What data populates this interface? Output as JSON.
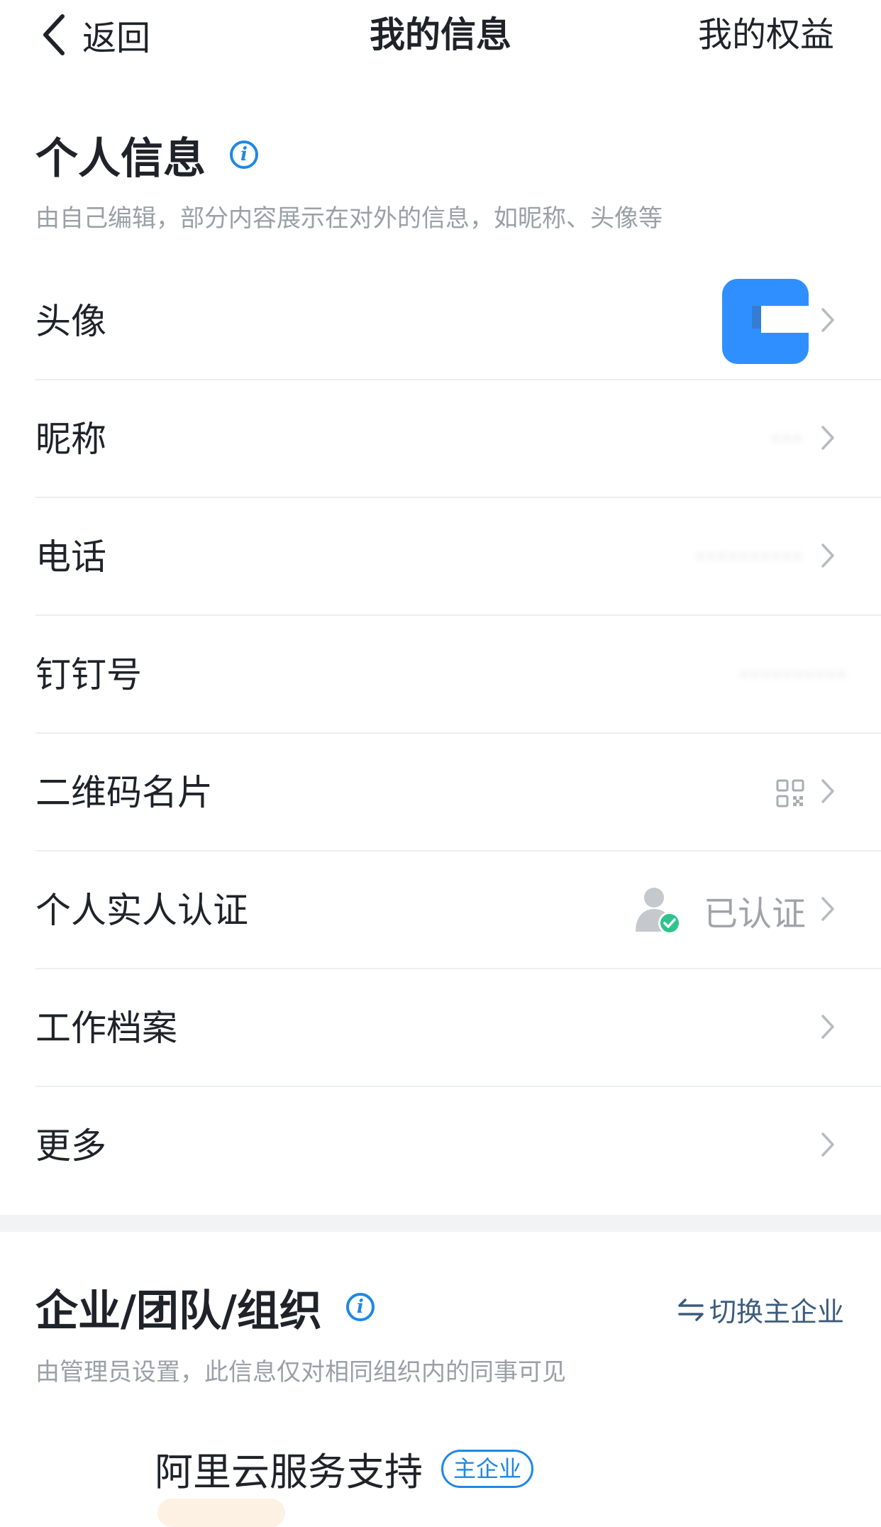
{
  "nav": {
    "back_label": "返回",
    "title": "我的信息",
    "right_label": "我的权益"
  },
  "personal": {
    "title": "个人信息",
    "subtitle": "由自己编辑，部分内容展示在对外的信息，如昵称、头像等",
    "rows": [
      {
        "label": "头像"
      },
      {
        "label": "昵称",
        "value": "···"
      },
      {
        "label": "电话",
        "value": "··········"
      },
      {
        "label": "钉钉号",
        "value": "··········"
      },
      {
        "label": "二维码名片"
      },
      {
        "label": "个人实人认证",
        "value": "已认证"
      },
      {
        "label": "工作档案"
      },
      {
        "label": "更多"
      }
    ]
  },
  "org": {
    "title": "企业/团队/组织",
    "subtitle": "由管理员设置，此信息仅对相同组织内的同事可见",
    "switch_label": "切换主企业",
    "company": "阿里云服务支持",
    "badge": "主企业"
  },
  "colors": {
    "accent": "#1e88e5",
    "avatar_bg": "#2f8fff",
    "verified_green": "#2fc48d",
    "muted_text": "#9aa0a6"
  },
  "icons": [
    "back-arrow-icon",
    "info-icon",
    "chevron-right-icon",
    "qr-code-icon",
    "person-verified-icon",
    "switch-arrows-icon"
  ]
}
